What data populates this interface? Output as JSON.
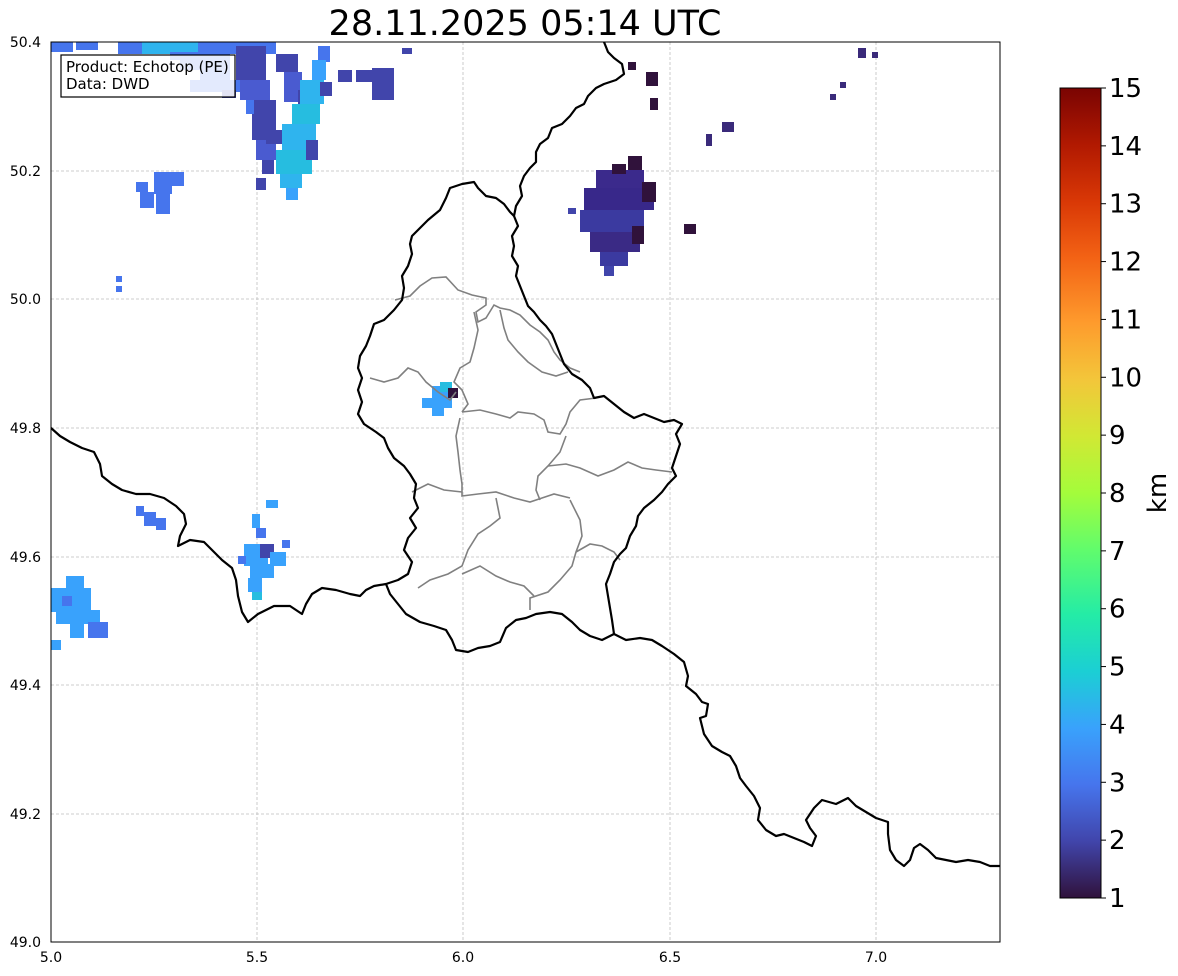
{
  "title": "28.11.2025 05:14 UTC",
  "info_box": {
    "product_line": "Product: Echotop (PE)",
    "data_line": "Data: DWD"
  },
  "map": {
    "lon_range": [
      5.0,
      7.3
    ],
    "lat_range": [
      49.0,
      50.4
    ],
    "x_ticks": [
      "5.0",
      "5.5",
      "6.0",
      "6.5",
      "7.0"
    ],
    "y_ticks": [
      "50.4",
      "50.2",
      "50.0",
      "49.8",
      "49.6",
      "49.4",
      "49.2",
      "49.0"
    ],
    "grid": true,
    "features": [
      "national borders (black)",
      "Luxembourg district borders (grey)",
      "radar echo-top pixels"
    ]
  },
  "colorbar": {
    "unit": "km",
    "min": 1,
    "max": 15,
    "labels": [
      "15",
      "14",
      "13",
      "12",
      "11",
      "10",
      "9",
      "8",
      "7",
      "6",
      "5",
      "4",
      "3",
      "2",
      "1"
    ],
    "colormap": "turbo",
    "colors": [
      "#30123b",
      "#4145ab",
      "#4675ed",
      "#39a2fc",
      "#1bcfd4",
      "#24eca6",
      "#61fc6c",
      "#a4fc3b",
      "#d1e834",
      "#f3c63a",
      "#fe9b2d",
      "#f36315",
      "#d93806",
      "#b11901",
      "#7a0402"
    ]
  },
  "echo_regions": [
    {
      "area": "north-west top corner",
      "approx_lon": "5.0–5.8",
      "approx_lat": "50.15–50.4",
      "height_km": "2–4.5"
    },
    {
      "area": "central north east of Luxembourg",
      "approx_lon": "6.28–6.46",
      "approx_lat": "50.03–50.22",
      "height_km": "1–2"
    },
    {
      "area": "north-west of Luxembourg",
      "approx_lon": "5.93–5.97",
      "approx_lat": "49.82–49.86",
      "height_km": "3.5–4.5"
    },
    {
      "area": "south-west",
      "approx_lon": "5.45–5.58",
      "approx_lat": "49.53–49.68",
      "height_km": "3.5–4.5"
    },
    {
      "area": "far west",
      "approx_lon": "5.0–5.14",
      "approx_lat": "49.46–49.57",
      "height_km": "3–3.5"
    }
  ]
}
